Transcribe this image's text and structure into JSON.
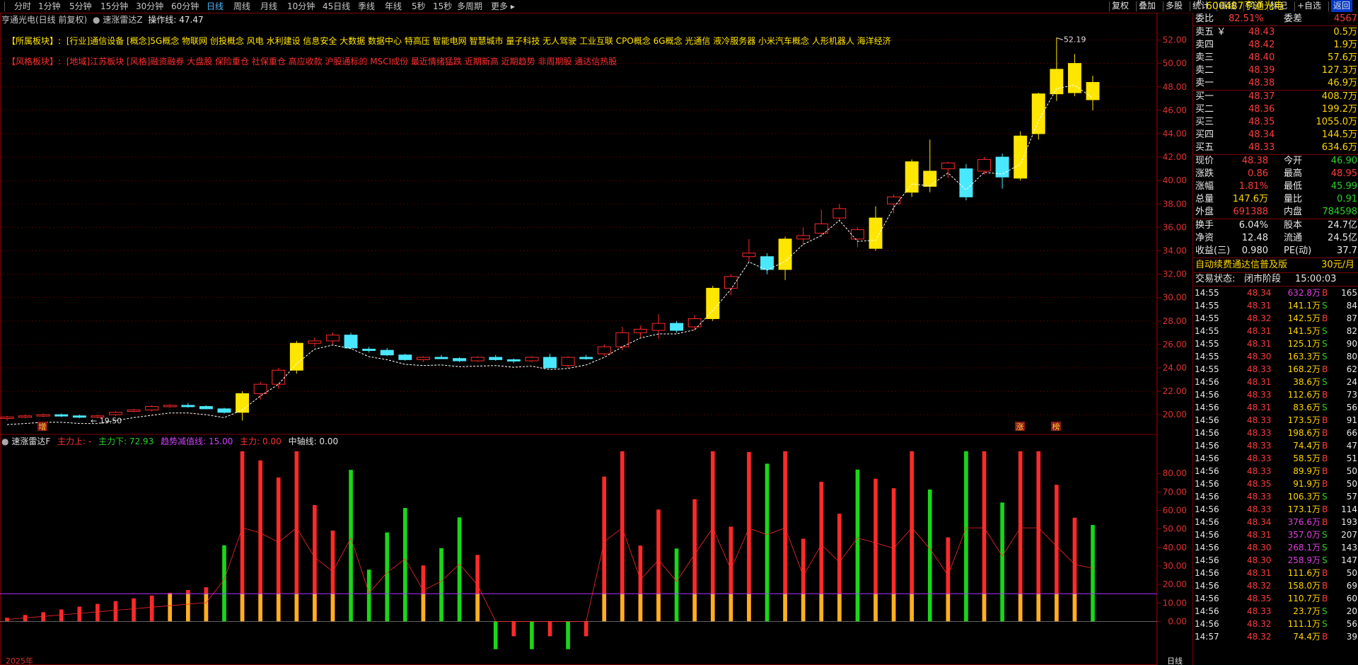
{
  "toolbar": {
    "periods": [
      "分时",
      "1分钟",
      "5分钟",
      "15分钟",
      "30分钟",
      "60分钟",
      "日线",
      "周线",
      "月线",
      "10分钟",
      "45日线",
      "季线",
      "年线",
      "5秒",
      "15秒",
      "多周期",
      "更多"
    ],
    "active_period": "日线",
    "right_buttons": [
      "复权",
      "叠加",
      "多股",
      "统计",
      "画线",
      "F10",
      "标记",
      "+自选",
      "返回"
    ]
  },
  "chart_header": {
    "stock_title": "亨通光电(日线 前复权)",
    "indicator_name": "速涨雷达Z",
    "operation_label": "操作线: 47.47"
  },
  "sector_info": {
    "belong_label": "【所属板块】:",
    "belong_text": "[行业]通信设备 [概念]5G概念 物联网 创投概念 风电 水利建设 信息安全 大数据 数据中心 特高压 智能电网 智慧城市 量子科技 无人驾驶 工业互联 CPO概念 6G概念 光通信 液冷服务器 小米汽车概念 人形机器人 海洋经济",
    "style_label": "【风格板块】:",
    "style_text": "[地域]江苏板块 [风格]融资融券 大盘股 保险重仓 社保重仓 高应收款 沪股通标的 MSCI成份 最近情绪猛跌 近期新高 近期趋势 非周期股 通达信热股"
  },
  "main_chart": {
    "y_ticks": [
      "52.00",
      "50.00",
      "48.00",
      "46.00",
      "44.00",
      "42.00",
      "40.00",
      "38.00",
      "36.00",
      "34.00",
      "32.00",
      "30.00",
      "28.00",
      "26.00",
      "24.00",
      "22.00",
      "20.00"
    ],
    "high_label": "52.19",
    "low_label": "19.50",
    "bottom_markers": [
      "增",
      "涨",
      "榜"
    ]
  },
  "sub_chart": {
    "indicator_name": "速涨雷达F",
    "main_up_label": "主力上: -",
    "main_down_label": "主力下: 72.93",
    "trend_label": "趋势减值线: 15.00",
    "main_force_label": "主力: 0.00",
    "center_label": "中轴线: 0.00",
    "y_ticks": [
      "80.00",
      "70.00",
      "60.00",
      "50.00",
      "40.00",
      "30.00",
      "20.00",
      "10.00",
      "0.00"
    ],
    "x_labels": [
      "2025年",
      "日线"
    ]
  },
  "chart_data": {
    "type": "candlestick",
    "ylim": [
      18.5,
      53
    ],
    "candles": [
      {
        "o": 19.7,
        "h": 19.9,
        "l": 19.5,
        "c": 19.8
      },
      {
        "o": 19.8,
        "h": 20.0,
        "l": 19.7,
        "c": 19.9
      },
      {
        "o": 19.9,
        "h": 20.1,
        "l": 19.8,
        "c": 20.0
      },
      {
        "o": 20.0,
        "h": 20.1,
        "l": 19.8,
        "c": 19.9
      },
      {
        "o": 19.9,
        "h": 20.0,
        "l": 19.7,
        "c": 19.8
      },
      {
        "o": 19.8,
        "h": 20.0,
        "l": 19.7,
        "c": 19.9
      },
      {
        "o": 20.0,
        "h": 20.3,
        "l": 19.9,
        "c": 20.2
      },
      {
        "o": 20.3,
        "h": 20.5,
        "l": 20.2,
        "c": 20.4
      },
      {
        "o": 20.4,
        "h": 20.8,
        "l": 20.3,
        "c": 20.7
      },
      {
        "o": 20.7,
        "h": 20.9,
        "l": 20.6,
        "c": 20.8
      },
      {
        "o": 20.8,
        "h": 21.0,
        "l": 20.6,
        "c": 20.7
      },
      {
        "o": 20.7,
        "h": 20.8,
        "l": 20.5,
        "c": 20.5
      },
      {
        "o": 20.5,
        "h": 20.6,
        "l": 20.1,
        "c": 20.2
      },
      {
        "o": 20.2,
        "h": 22.0,
        "l": 19.5,
        "c": 21.8
      },
      {
        "o": 21.8,
        "h": 22.8,
        "l": 21.3,
        "c": 22.6
      },
      {
        "o": 22.6,
        "h": 24.0,
        "l": 22.2,
        "c": 23.8
      },
      {
        "o": 23.8,
        "h": 26.3,
        "l": 23.5,
        "c": 26.1
      },
      {
        "o": 26.1,
        "h": 26.6,
        "l": 25.8,
        "c": 26.3
      },
      {
        "o": 26.3,
        "h": 27.0,
        "l": 26.0,
        "c": 26.8
      },
      {
        "o": 26.8,
        "h": 27.0,
        "l": 25.6,
        "c": 25.7
      },
      {
        "o": 25.6,
        "h": 25.8,
        "l": 25.3,
        "c": 25.5
      },
      {
        "o": 25.5,
        "h": 25.7,
        "l": 25.0,
        "c": 25.1
      },
      {
        "o": 25.1,
        "h": 25.2,
        "l": 24.6,
        "c": 24.7
      },
      {
        "o": 24.7,
        "h": 25.0,
        "l": 24.5,
        "c": 24.9
      },
      {
        "o": 24.9,
        "h": 25.1,
        "l": 24.8,
        "c": 24.8
      },
      {
        "o": 24.8,
        "h": 24.9,
        "l": 24.5,
        "c": 24.6
      },
      {
        "o": 24.6,
        "h": 25.0,
        "l": 24.5,
        "c": 24.9
      },
      {
        "o": 24.9,
        "h": 25.1,
        "l": 24.6,
        "c": 24.7
      },
      {
        "o": 24.7,
        "h": 24.8,
        "l": 24.4,
        "c": 24.6
      },
      {
        "o": 24.6,
        "h": 25.0,
        "l": 24.5,
        "c": 24.9
      },
      {
        "o": 24.9,
        "h": 25.2,
        "l": 24.3,
        "c": 24.0
      },
      {
        "o": 24.2,
        "h": 25.0,
        "l": 24.0,
        "c": 24.9
      },
      {
        "o": 24.9,
        "h": 25.1,
        "l": 24.7,
        "c": 24.8
      },
      {
        "o": 25.2,
        "h": 26.0,
        "l": 25.0,
        "c": 25.8
      },
      {
        "o": 25.8,
        "h": 27.5,
        "l": 25.5,
        "c": 27.0
      },
      {
        "o": 27.0,
        "h": 27.6,
        "l": 26.6,
        "c": 27.3
      },
      {
        "o": 27.2,
        "h": 28.6,
        "l": 26.5,
        "c": 27.8
      },
      {
        "o": 27.8,
        "h": 28.0,
        "l": 27.0,
        "c": 27.2
      },
      {
        "o": 27.5,
        "h": 28.5,
        "l": 27.2,
        "c": 28.2
      },
      {
        "o": 28.2,
        "h": 31.0,
        "l": 28.0,
        "c": 30.8
      },
      {
        "o": 30.8,
        "h": 32.0,
        "l": 30.2,
        "c": 31.8
      },
      {
        "o": 33.5,
        "h": 35.0,
        "l": 33.0,
        "c": 33.8
      },
      {
        "o": 33.5,
        "h": 33.8,
        "l": 32.0,
        "c": 32.4
      },
      {
        "o": 32.4,
        "h": 35.2,
        "l": 31.5,
        "c": 35.0
      },
      {
        "o": 35.0,
        "h": 36.0,
        "l": 34.5,
        "c": 35.3
      },
      {
        "o": 35.5,
        "h": 37.5,
        "l": 35.2,
        "c": 36.3
      },
      {
        "o": 36.8,
        "h": 38.0,
        "l": 36.5,
        "c": 37.6
      },
      {
        "o": 35.0,
        "h": 36.0,
        "l": 34.3,
        "c": 35.8
      },
      {
        "o": 34.2,
        "h": 37.8,
        "l": 34.0,
        "c": 36.8
      },
      {
        "o": 38.0,
        "h": 38.8,
        "l": 37.2,
        "c": 38.6
      },
      {
        "o": 39.0,
        "h": 41.8,
        "l": 38.6,
        "c": 41.6
      },
      {
        "o": 39.5,
        "h": 43.5,
        "l": 39.0,
        "c": 40.8
      },
      {
        "o": 41.0,
        "h": 41.6,
        "l": 40.2,
        "c": 41.5
      },
      {
        "o": 41.0,
        "h": 41.4,
        "l": 38.3,
        "c": 38.6
      },
      {
        "o": 40.8,
        "h": 42.0,
        "l": 40.5,
        "c": 41.8
      },
      {
        "o": 42.0,
        "h": 42.3,
        "l": 39.3,
        "c": 40.3
      },
      {
        "o": 40.2,
        "h": 44.2,
        "l": 40.0,
        "c": 43.8
      },
      {
        "o": 44.0,
        "h": 47.5,
        "l": 43.5,
        "c": 47.4
      },
      {
        "o": 47.4,
        "h": 52.2,
        "l": 46.8,
        "c": 49.5
      },
      {
        "o": 47.5,
        "h": 50.8,
        "l": 47.2,
        "c": 50.0
      },
      {
        "o": 46.9,
        "h": 48.95,
        "l": 45.99,
        "c": 48.38
      }
    ]
  },
  "order_book": {
    "stock_code": "600487",
    "stock_name": "亨通光电",
    "r_label": "R",
    "weibi_label": "委比",
    "weibi_value": "82.51%",
    "weicha_label": "委差",
    "weicha_value": "4567",
    "sells": [
      {
        "label": "卖五",
        "mark": "￥",
        "price": "48.43",
        "vol": "0.5万"
      },
      {
        "label": "卖四",
        "mark": "",
        "price": "48.42",
        "vol": "1.9万"
      },
      {
        "label": "卖三",
        "mark": "",
        "price": "48.40",
        "vol": "57.6万"
      },
      {
        "label": "卖二",
        "mark": "",
        "price": "48.39",
        "vol": "127.3万"
      },
      {
        "label": "卖一",
        "mark": "",
        "price": "48.38",
        "vol": "46.9万"
      }
    ],
    "buys": [
      {
        "label": "买一",
        "price": "48.37",
        "vol": "408.7万"
      },
      {
        "label": "买二",
        "price": "48.36",
        "vol": "199.2万"
      },
      {
        "label": "买三",
        "price": "48.35",
        "vol": "1055.0万"
      },
      {
        "label": "买四",
        "price": "48.34",
        "vol": "144.5万"
      },
      {
        "label": "买五",
        "price": "48.33",
        "vol": "634.6万"
      }
    ],
    "stats": [
      {
        "l1": "现价",
        "v1": "48.38",
        "c1": "red",
        "l2": "今开",
        "v2": "46.90",
        "c2": "green"
      },
      {
        "l1": "涨跌",
        "v1": "0.86",
        "c1": "red",
        "l2": "最高",
        "v2": "48.95",
        "c2": "red"
      },
      {
        "l1": "涨幅",
        "v1": "1.81%",
        "c1": "red",
        "l2": "最低",
        "v2": "45.99",
        "c2": "green"
      },
      {
        "l1": "总量",
        "v1": "147.6万",
        "c1": "yellow",
        "l2": "量比",
        "v2": "0.91",
        "c2": "green"
      },
      {
        "l1": "外盘",
        "v1": "691388",
        "c1": "red",
        "l2": "内盘",
        "v2": "784598",
        "c2": "green"
      }
    ],
    "fundamentals": [
      {
        "l1": "换手",
        "v1": "6.04%",
        "l2": "股本",
        "v2": "24.7亿"
      },
      {
        "l1": "净资",
        "v1": "12.48",
        "l2": "流通",
        "v2": "24.5亿"
      },
      {
        "l1": "收益(三)",
        "v1": "0.980",
        "l2": "PE(动)",
        "v2": "37.7"
      }
    ],
    "promo_text": "自动续费通达信普及版",
    "promo_price": "30元/月",
    "trade_status_label": "交易状态:",
    "trade_status_value": "闭市阶段",
    "trade_time": "15:00:03"
  },
  "ticks": [
    {
      "t": "14:55",
      "p": "48.34",
      "v": "632.8万",
      "s": "B",
      "n": "165"
    },
    {
      "t": "14:55",
      "p": "48.31",
      "v": "141.1万",
      "s": "S",
      "n": "84"
    },
    {
      "t": "14:55",
      "p": "48.32",
      "v": "142.5万",
      "s": "B",
      "n": "87"
    },
    {
      "t": "14:55",
      "p": "48.31",
      "v": "141.5万",
      "s": "S",
      "n": "82"
    },
    {
      "t": "14:55",
      "p": "48.31",
      "v": "125.1万",
      "s": "S",
      "n": "90"
    },
    {
      "t": "14:55",
      "p": "48.30",
      "v": "163.3万",
      "s": "S",
      "n": "80"
    },
    {
      "t": "14:55",
      "p": "48.33",
      "v": "168.2万",
      "s": "B",
      "n": "62"
    },
    {
      "t": "14:56",
      "p": "48.31",
      "v": "38.6万",
      "s": "S",
      "n": "24"
    },
    {
      "t": "14:56",
      "p": "48.33",
      "v": "112.6万",
      "s": "B",
      "n": "73"
    },
    {
      "t": "14:56",
      "p": "48.31",
      "v": "83.6万",
      "s": "S",
      "n": "56"
    },
    {
      "t": "14:56",
      "p": "48.33",
      "v": "173.5万",
      "s": "B",
      "n": "91"
    },
    {
      "t": "14:56",
      "p": "48.33",
      "v": "198.6万",
      "s": "B",
      "n": "66"
    },
    {
      "t": "14:56",
      "p": "48.33",
      "v": "74.4万",
      "s": "B",
      "n": "47"
    },
    {
      "t": "14:56",
      "p": "48.33",
      "v": "58.5万",
      "s": "B",
      "n": "51"
    },
    {
      "t": "14:56",
      "p": "48.33",
      "v": "89.9万",
      "s": "B",
      "n": "50"
    },
    {
      "t": "14:56",
      "p": "48.35",
      "v": "91.9万",
      "s": "B",
      "n": "50"
    },
    {
      "t": "14:56",
      "p": "48.33",
      "v": "106.3万",
      "s": "S",
      "n": "57"
    },
    {
      "t": "14:56",
      "p": "48.33",
      "v": "173.1万",
      "s": "B",
      "n": "114"
    },
    {
      "t": "14:56",
      "p": "48.34",
      "v": "376.6万",
      "s": "B",
      "n": "193"
    },
    {
      "t": "14:56",
      "p": "48.31",
      "v": "357.0万",
      "s": "S",
      "n": "207"
    },
    {
      "t": "14:56",
      "p": "48.30",
      "v": "268.1万",
      "s": "S",
      "n": "143"
    },
    {
      "t": "14:56",
      "p": "48.30",
      "v": "258.9万",
      "s": "S",
      "n": "147"
    },
    {
      "t": "14:56",
      "p": "48.31",
      "v": "111.6万",
      "s": "B",
      "n": "50"
    },
    {
      "t": "14:56",
      "p": "48.32",
      "v": "158.0万",
      "s": "B",
      "n": "69"
    },
    {
      "t": "14:56",
      "p": "48.35",
      "v": "110.7万",
      "s": "B",
      "n": "60"
    },
    {
      "t": "14:56",
      "p": "48.33",
      "v": "23.7万",
      "s": "S",
      "n": "20"
    },
    {
      "t": "14:56",
      "p": "48.32",
      "v": "111.1万",
      "s": "S",
      "n": "56"
    },
    {
      "t": "14:57",
      "p": "48.32",
      "v": "74.4万",
      "s": "B",
      "n": "39"
    }
  ],
  "colors": {
    "up": "#ff2a2a",
    "down": "#4ae8ff",
    "yellow": "#ffe600",
    "green": "#18d818",
    "grid": "#7a0000",
    "purple": "#b030ff"
  }
}
